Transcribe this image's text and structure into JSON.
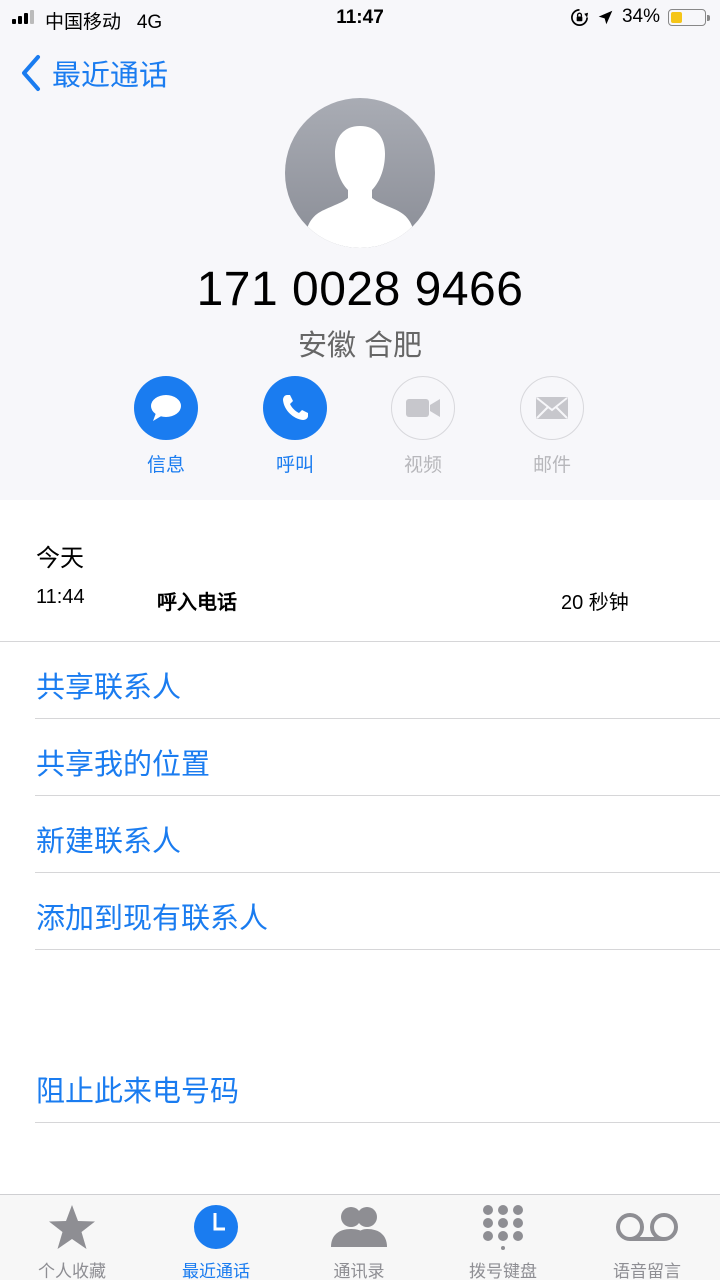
{
  "status_bar": {
    "carrier": "中国移动",
    "network": "4G",
    "time": "11:47",
    "battery_percent": "34%",
    "battery_level": 0.34
  },
  "nav": {
    "back_label": "最近通话"
  },
  "contact": {
    "number": "171 0028 9466",
    "location": "安徽 合肥"
  },
  "actions": [
    {
      "label": "信息",
      "icon": "message-bubble-icon",
      "enabled": true
    },
    {
      "label": "呼叫",
      "icon": "phone-icon",
      "enabled": true
    },
    {
      "label": "视频",
      "icon": "video-camera-icon",
      "enabled": false
    },
    {
      "label": "邮件",
      "icon": "envelope-icon",
      "enabled": false
    }
  ],
  "history": {
    "day": "今天",
    "entries": [
      {
        "time": "11:44",
        "type": "呼入电话",
        "duration": "20 秒钟"
      }
    ]
  },
  "options": [
    "共享联系人",
    "共享我的位置",
    "新建联系人",
    "添加到现有联系人"
  ],
  "block": "阻止此来电号码",
  "tabs": [
    {
      "label": "个人收藏",
      "icon": "star-icon",
      "active": false
    },
    {
      "label": "最近通话",
      "icon": "clock-icon",
      "active": true
    },
    {
      "label": "通讯录",
      "icon": "contacts-icon",
      "active": false
    },
    {
      "label": "拨号键盘",
      "icon": "keypad-icon",
      "active": false
    },
    {
      "label": "语音留言",
      "icon": "voicemail-icon",
      "active": false
    }
  ],
  "colors": {
    "accent": "#1a7cf0",
    "disabled": "#b7b7bb",
    "tab_inactive": "#8e8e93",
    "battery": "#f5c518"
  }
}
